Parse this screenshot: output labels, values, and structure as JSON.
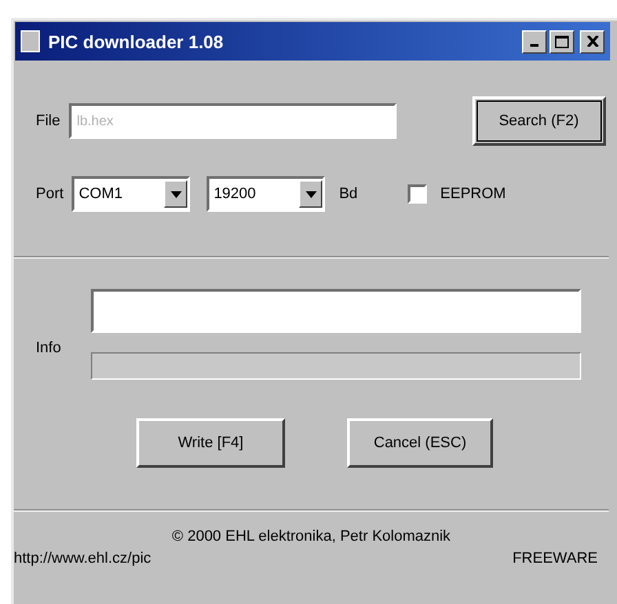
{
  "window": {
    "title": "PIC downloader 1.08"
  },
  "file": {
    "label": "File",
    "placeholder": "lb.hex",
    "button": "Search (F2)"
  },
  "port": {
    "label": "Port",
    "port_value": "COM1",
    "baud_value": "19200",
    "baud_unit": "Bd",
    "eeprom": {
      "label": "EEPROM",
      "checked": false
    }
  },
  "info": {
    "label": "Info",
    "progress": {
      "level": 0
    }
  },
  "buttons": [
    "Write [F4]",
    "Cancel (ESC)"
  ],
  "footer": {
    "copyright": "© 2000 EHL elektronika, Petr Kolomaznik",
    "url": "http://www.ehl.cz/pic",
    "license": "FREEWARE"
  }
}
